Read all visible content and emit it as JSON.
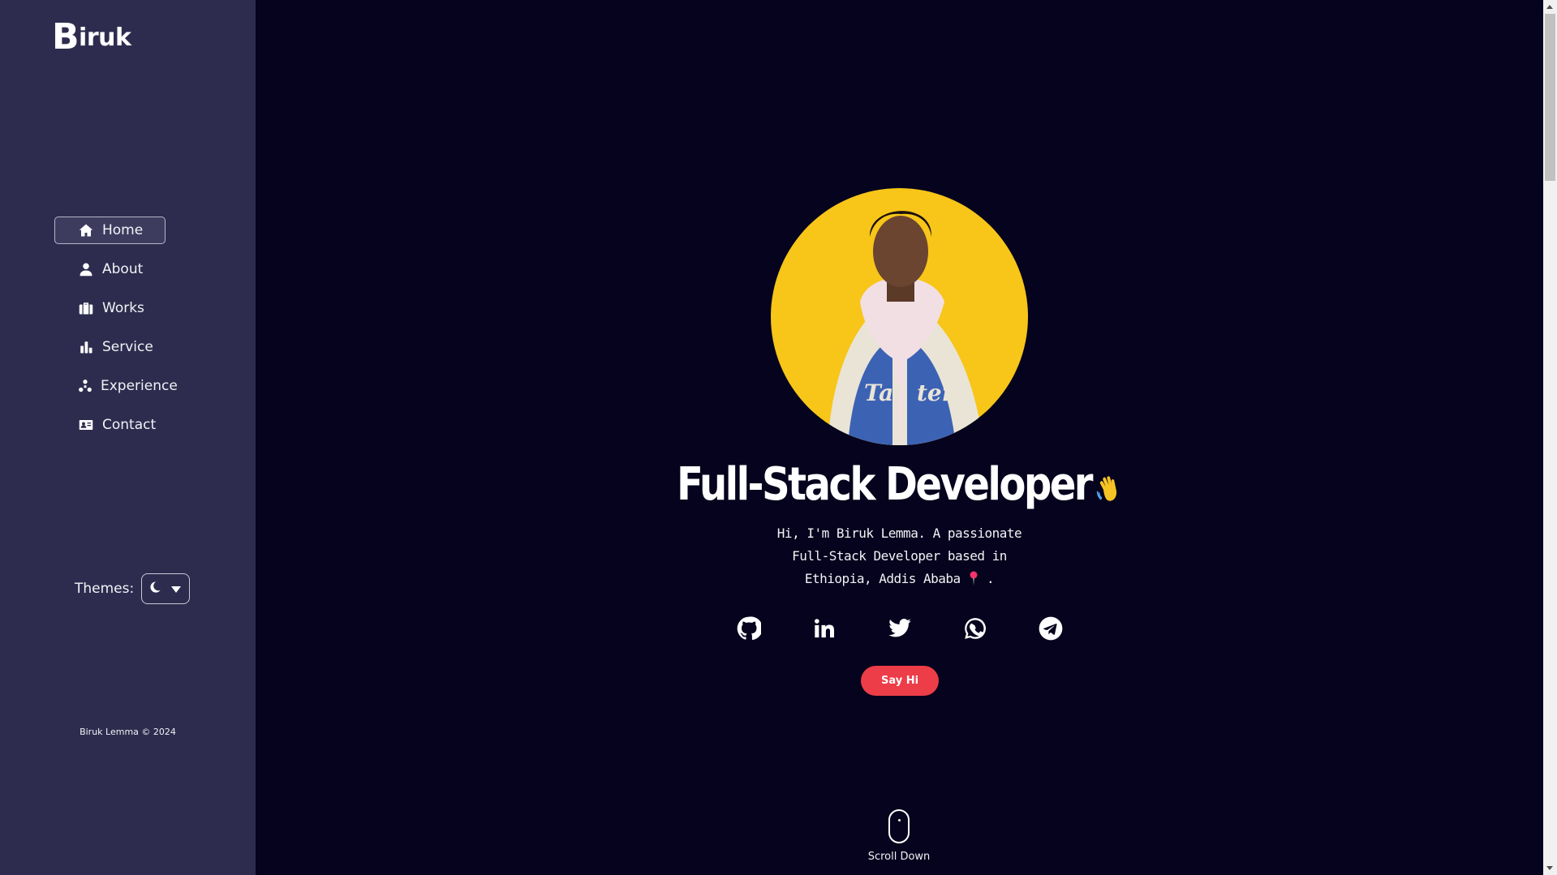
{
  "sidebar": {
    "logo": {
      "initial": "B",
      "rest": "iruk"
    },
    "nav": [
      {
        "label": "Home",
        "icon": "home-icon",
        "active": true
      },
      {
        "label": "About",
        "icon": "user-icon",
        "active": false
      },
      {
        "label": "Works",
        "icon": "briefcase-icon",
        "active": false
      },
      {
        "label": "Service",
        "icon": "bar-chart-icon",
        "active": false
      },
      {
        "label": "Experience",
        "icon": "sitemap-icon",
        "active": false
      },
      {
        "label": "Contact",
        "icon": "address-card-icon",
        "active": false
      }
    ],
    "themes": {
      "label": "Themes:",
      "selected_icon": "moon-icon"
    },
    "copyright": "Biruk Lemma © 2024"
  },
  "hero": {
    "headline": "Full-Stack Developer",
    "headline_emoji": "waving-hand-icon",
    "intro": "Hi, I'm Biruk Lemma. A passionate Full-Stack Developer based in Ethiopia, Addis Ababa",
    "intro_suffix": ".",
    "intro_emoji": "round-pushpin-icon",
    "socials": [
      "github-icon",
      "linkedin-icon",
      "twitter-icon",
      "whatsapp-icon",
      "telegram-icon"
    ],
    "cta_label": "Say Hi",
    "scroll_label": "Scroll Down"
  },
  "colors": {
    "sidebar_bg": "#2e2c4e",
    "main_bg": "#05031d",
    "accent": "#ed3d48",
    "avatar_bg": "#f8c519"
  }
}
